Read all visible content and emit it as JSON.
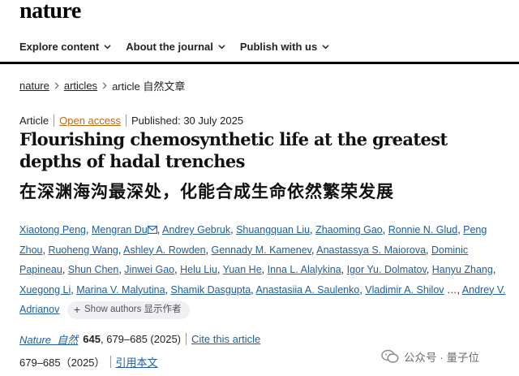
{
  "site": {
    "logo": "nature"
  },
  "nav": {
    "items": [
      {
        "label": "Explore content"
      },
      {
        "label": "About the journal"
      },
      {
        "label": "Publish with us"
      }
    ]
  },
  "breadcrumb": {
    "items": [
      "nature",
      "articles",
      "article 自然文章"
    ]
  },
  "meta": {
    "type": "Article",
    "access": "Open access",
    "published": "Published: 30 July 2025"
  },
  "title": "Flourishing chemosynthetic life at the greatest depths of hadal trenches",
  "title_cn": "在深渊海沟最深处，化能合成生命依然繁荣发展",
  "authors": [
    "Xiaotong Peng",
    "Mengran Du",
    "Andrey Gebruk",
    "Shuangquan Liu",
    "Zhaoming Gao",
    "Ronnie N. Glud",
    "Peng Zhou",
    "Ruoheng Wang",
    "Ashley A. Rowden",
    "Gennady M. Kamenev",
    "Anastassya S. Maiorova",
    "Dominic Papineau",
    "Shun Chen",
    "Jinwei Gao",
    "Helu Liu",
    "Yuan He",
    "Inna L. Alalykina",
    "Igor Yu. Dolmatov",
    "Hanyu Zhang",
    "Xuegong Li",
    "Marina V. Malyutina",
    "Shamik Dasgupta",
    "Anastasiia A. Saulenko",
    "Vladimir A. Shilov",
    "…",
    "Andrey V. Adrianov"
  ],
  "show_authors": {
    "plus": "+",
    "label": "Show authors",
    "label_cn": "显示作者"
  },
  "journal": {
    "name": "Nature",
    "name_cn": "自然",
    "volume": "645",
    "pages": ", 679–685 (2025)",
    "cite": "Cite this article"
  },
  "cite_cn": {
    "pages": "679–685（2025）",
    "label": "引用本文"
  },
  "watermark": {
    "text": "公众号 · 量子位"
  },
  "colors": {
    "link": "#1f5e9c",
    "open_access": "#c06a12"
  }
}
